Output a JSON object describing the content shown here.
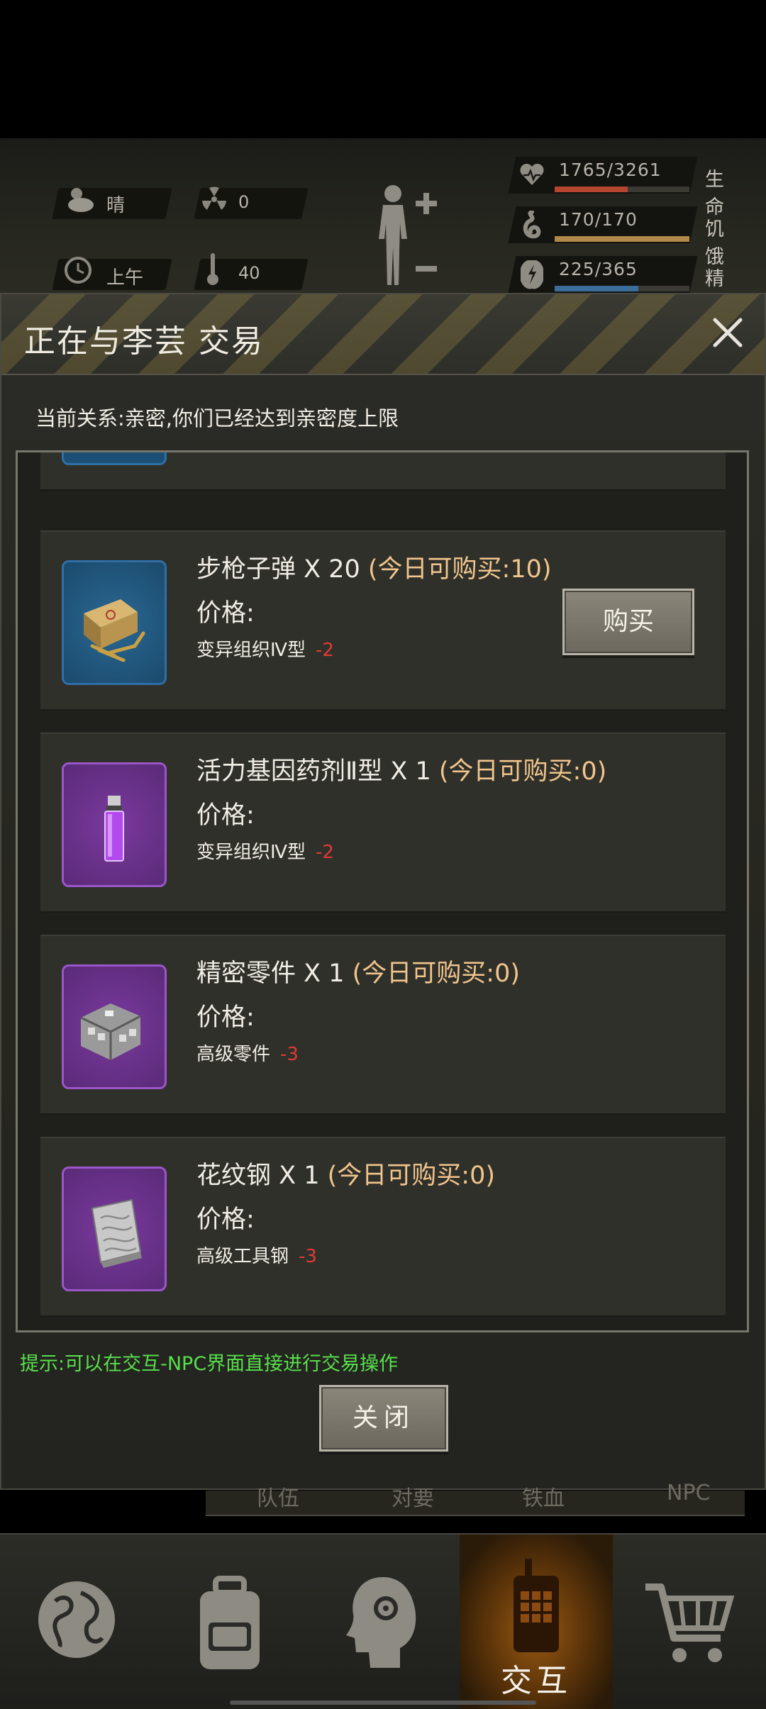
{
  "status": {
    "weather": "晴",
    "radiation": "0",
    "time_of_day": "上午",
    "temperature": "40",
    "bars": [
      {
        "label": "生命",
        "value": "1765/3261",
        "fraction": 0.54,
        "color": "#b5452f",
        "icon": "heart-icon"
      },
      {
        "label": "饥饿",
        "value": "170/170",
        "fraction": 1.0,
        "color": "#b0884a",
        "icon": "stomach-icon"
      },
      {
        "label": "精力",
        "value": "225/365",
        "fraction": 0.62,
        "color": "#3a6d9a",
        "icon": "energy-icon"
      }
    ]
  },
  "dialog": {
    "title": "正在与李芸 交易",
    "relation": "当前关系:亲密,你们已经达到亲密度上限",
    "price_label": "价格:",
    "buy_label": "购买",
    "hint": "提示:可以在交互-NPC界面直接进行交易操作",
    "close_label": "关闭"
  },
  "items": [
    {
      "name": "步枪子弹 X 20",
      "limit": "(今日可购买:10)",
      "cost_item": "变异组织Ⅳ型",
      "cost_amount": "-2",
      "icon": "ammo-box-icon",
      "rarity_color": "#2f6fa6",
      "has_buy": true
    },
    {
      "name": "活力基因药剂Ⅱ型 X 1",
      "limit": "(今日可购买:0)",
      "cost_item": "变异组织Ⅳ型",
      "cost_amount": "-2",
      "icon": "vial-icon",
      "rarity_color": "#8a42b8",
      "has_buy": false
    },
    {
      "name": "精密零件 X 1",
      "limit": "(今日可购买:0)",
      "cost_item": "高级零件",
      "cost_amount": "-3",
      "icon": "gear-parts-icon",
      "rarity_color": "#8a42b8",
      "has_buy": false
    },
    {
      "name": "花纹钢 X 1",
      "limit": "(今日可购买:0)",
      "cost_item": "高级工具钢",
      "cost_amount": "-3",
      "icon": "damascus-steel-icon",
      "rarity_color": "#8a42b8",
      "has_buy": false
    }
  ],
  "underlying_tabs": [
    "队伍",
    "对要",
    "铁血",
    "NPC"
  ],
  "nav": {
    "interact_label": "交互",
    "items": [
      "globe-icon",
      "backpack-icon",
      "brain-head-icon",
      "walkie-talkie-icon",
      "cart-icon"
    ]
  }
}
